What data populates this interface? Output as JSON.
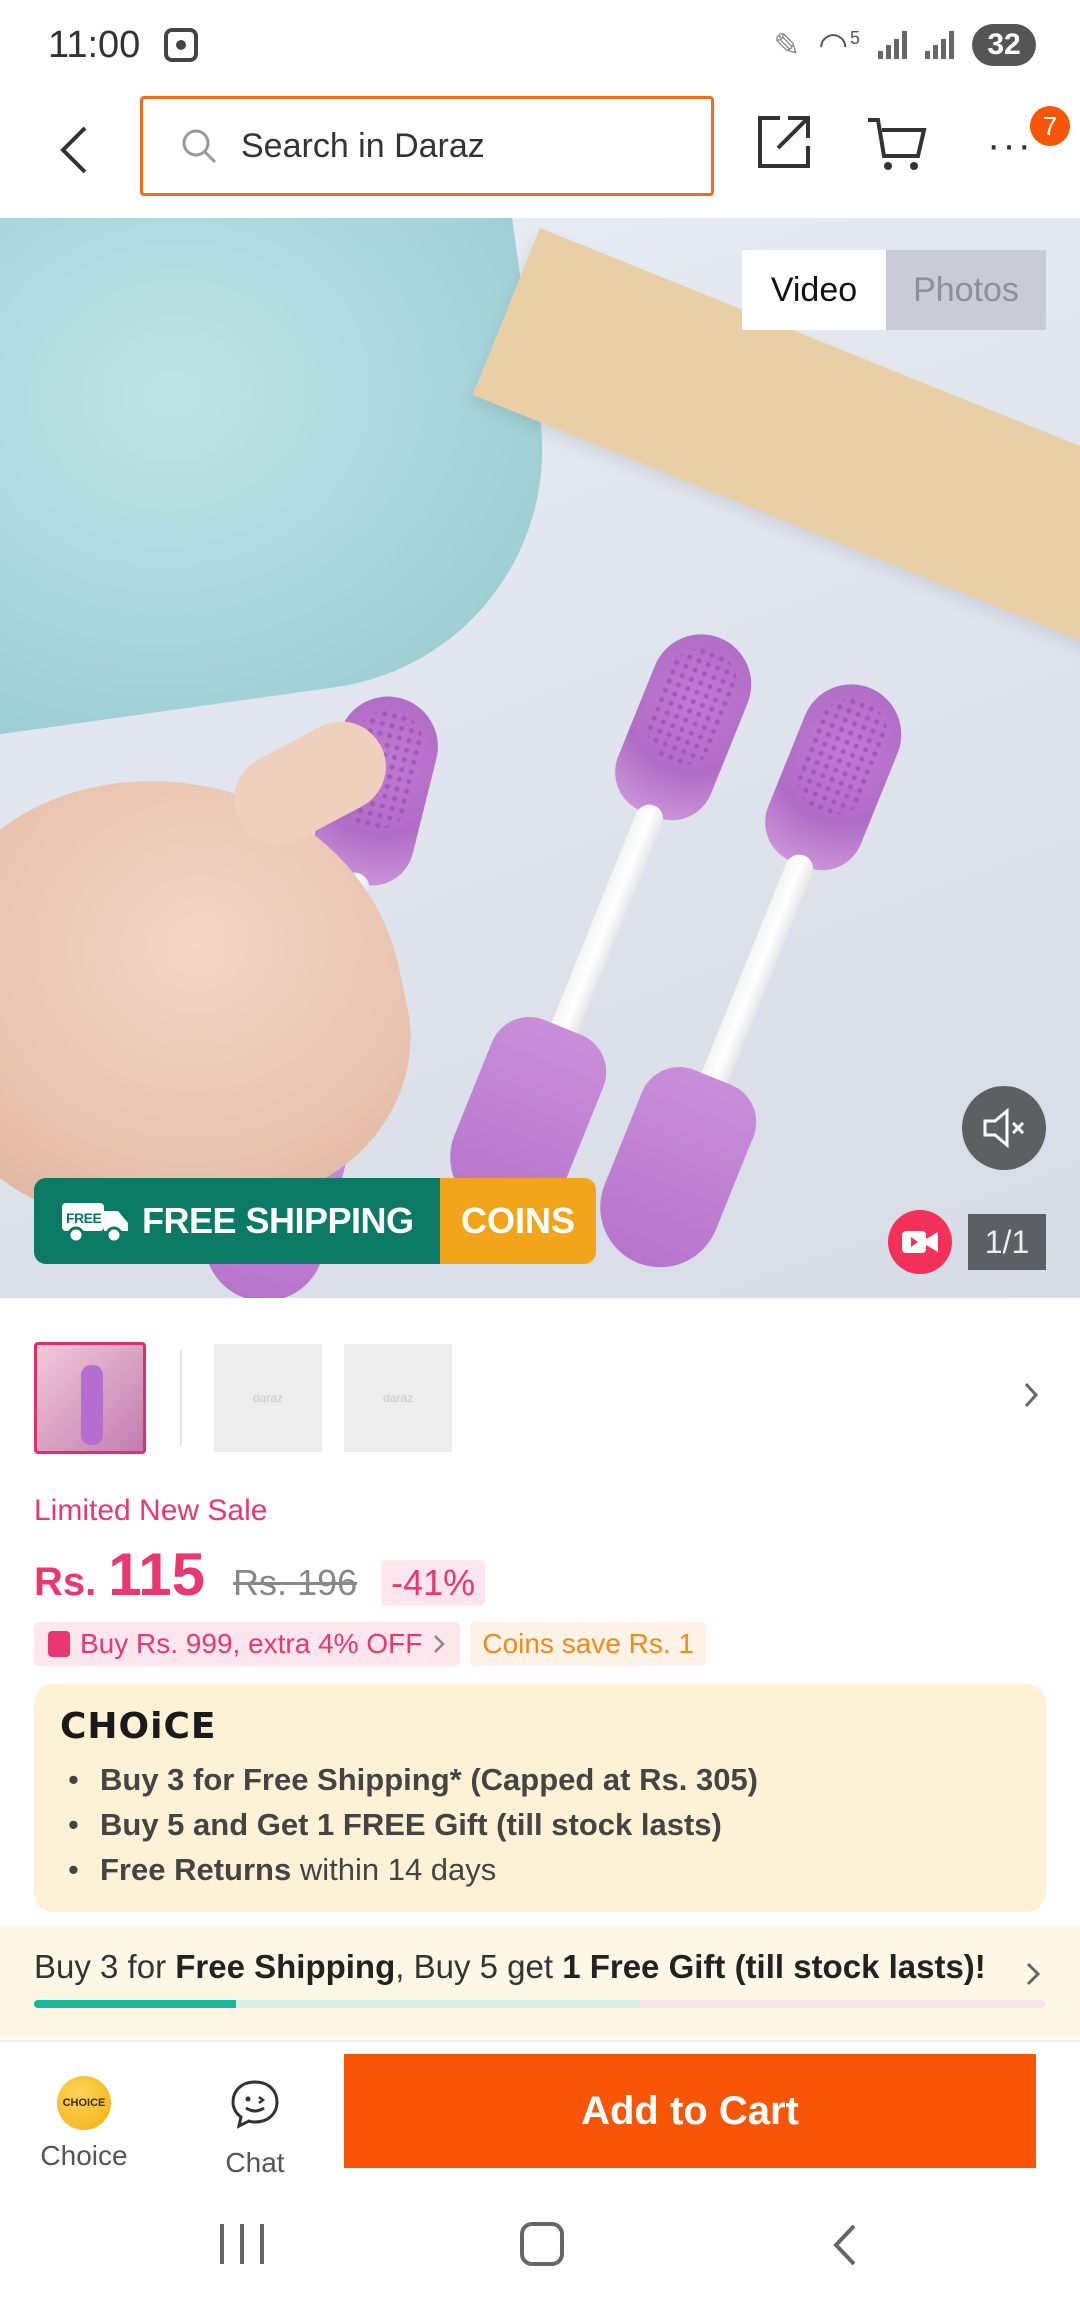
{
  "status_bar": {
    "time": "11:00",
    "network_label": "5",
    "battery": "32"
  },
  "header": {
    "search_placeholder": "Search in Daraz",
    "more_glyph": "···",
    "notification_count": "7"
  },
  "media": {
    "tabs": [
      {
        "label": "Video",
        "active": true
      },
      {
        "label": "Photos",
        "active": false
      }
    ],
    "counter": "1/1",
    "banner": {
      "left": "FREE SHIPPING",
      "right": "COINS",
      "truck_label": "FREE"
    }
  },
  "thumbnails": {
    "placeholder_text": "daraz"
  },
  "product": {
    "sale_label": "Limited New Sale",
    "currency": "Rs.",
    "price": "115",
    "old_price": "Rs. 196",
    "discount": "-41%",
    "promo_text": "Buy Rs. 999, extra 4% OFF",
    "coins_text": "Coins save Rs. 1"
  },
  "choice_card": {
    "logo": "CHOiCE",
    "items": [
      {
        "bold": "Buy 3 for  Free Shipping* (Capped at Rs. 305)",
        "rest": ""
      },
      {
        "bold": "Buy 5 and Get 1 FREE Gift (till stock lasts)",
        "rest": ""
      },
      {
        "bold": "Free Returns",
        "rest": " within 14 days"
      }
    ]
  },
  "bundle": {
    "part1": "Buy 3 for ",
    "part2": "Free Shipping",
    "part3": ", Buy 5 get ",
    "part4": "1 Free Gift (till stock lasts)!",
    "progress_fraction": 0.2
  },
  "bottom_bar": {
    "choice_label": "Choice",
    "choice_icon_text": "CHOICE",
    "chat_label": "Chat",
    "add_to_cart": "Add to Cart"
  },
  "colors": {
    "accent": "#f85606",
    "price": "#e8386f",
    "shipping_green": "#0a7a64",
    "coins_orange": "#f2a51a"
  },
  "icons": [
    "back-icon",
    "search-icon",
    "share-icon",
    "cart-icon",
    "more-icon",
    "mute-icon",
    "video-camera-icon",
    "chevron-right-icon",
    "chat-icon"
  ]
}
